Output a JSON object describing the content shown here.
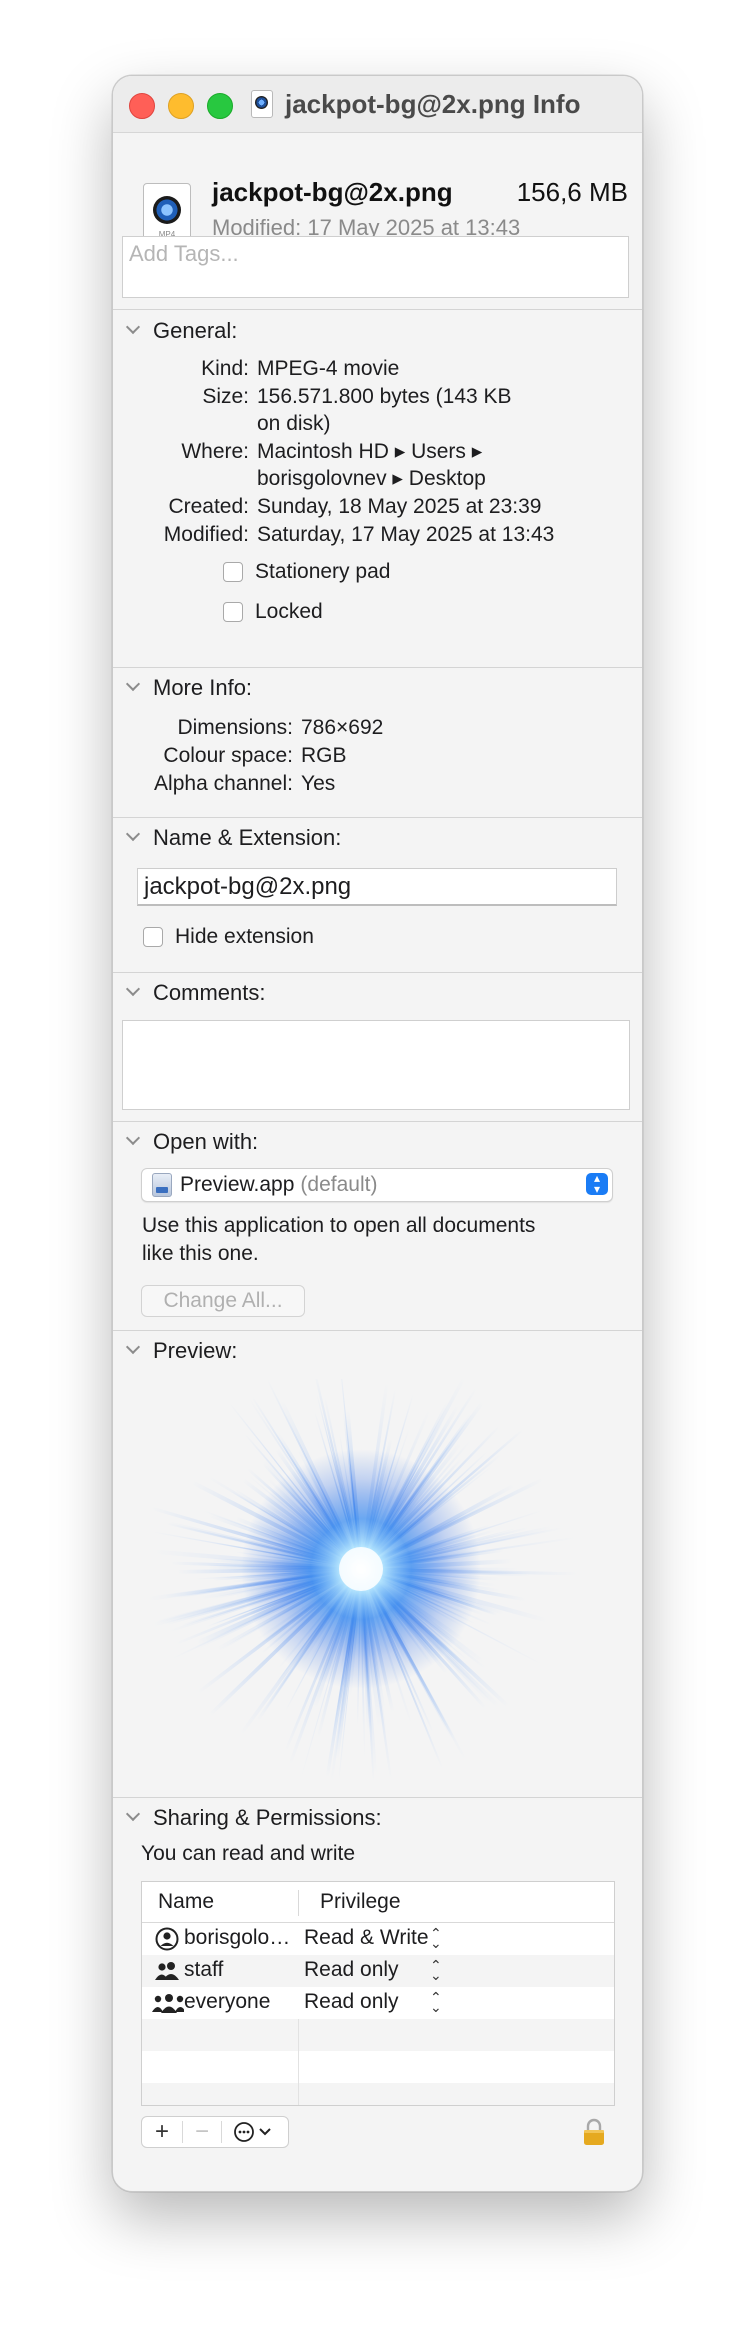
{
  "window": {
    "title": "jackpot-bg@2x.png Info"
  },
  "header": {
    "file_name": "jackpot-bg@2x.png",
    "file_size": "156,6 MB",
    "modified": "Modified: 17 May 2025 at 13:43",
    "file_icon_ext": "MP4",
    "tags_placeholder": "Add Tags..."
  },
  "general": {
    "title": "General:",
    "rows": [
      {
        "key": "Kind:",
        "value": "MPEG-4 movie"
      },
      {
        "key": "Size:",
        "value": "156.571.800 bytes (143 KB",
        "value2": "on disk)"
      },
      {
        "key": "Where:",
        "value": "Macintosh HD ▸ Users ▸",
        "value2": "borisgolovnev ▸ Desktop"
      },
      {
        "key": "Created:",
        "value": "Sunday, 18 May 2025 at 23:39"
      },
      {
        "key": "Modified:",
        "value": "Saturday, 17 May 2025 at 13:43"
      }
    ],
    "stationery_label": "Stationery pad",
    "locked_label": "Locked"
  },
  "more_info": {
    "title": "More Info:",
    "rows": [
      {
        "key": "Dimensions:",
        "value": "786×692"
      },
      {
        "key": "Colour space:",
        "value": "RGB"
      },
      {
        "key": "Alpha channel:",
        "value": "Yes"
      }
    ]
  },
  "name_extension": {
    "title": "Name & Extension:",
    "name_value": "jackpot-bg@2x.png",
    "hide_extension_label": "Hide extension"
  },
  "comments": {
    "title": "Comments:"
  },
  "open_with": {
    "title": "Open with:",
    "app_name": "Preview.app",
    "default_label": "(default)",
    "description_line1": "Use this application to open all documents",
    "description_line2": "like this one.",
    "change_all_label": "Change All..."
  },
  "preview": {
    "title": "Preview:"
  },
  "sharing": {
    "title": "Sharing & Permissions:",
    "status": "You can read and write",
    "col_name": "Name",
    "col_privilege": "Privilege",
    "rows": [
      {
        "name": "borisgolovnev...",
        "privilege": "Read & Write",
        "icon": "single-user-icon"
      },
      {
        "name": "staff",
        "privilege": "Read only",
        "icon": "group-icon"
      },
      {
        "name": "everyone",
        "privilege": "Read only",
        "icon": "everyone-icon"
      }
    ],
    "add_symbol": "+",
    "remove_symbol": "−"
  },
  "colors": {
    "close": "#ff5f57",
    "minimize": "#febc2e",
    "maximize": "#28c840",
    "accent": "#1a7cf5",
    "lock": "#e5a91f"
  }
}
